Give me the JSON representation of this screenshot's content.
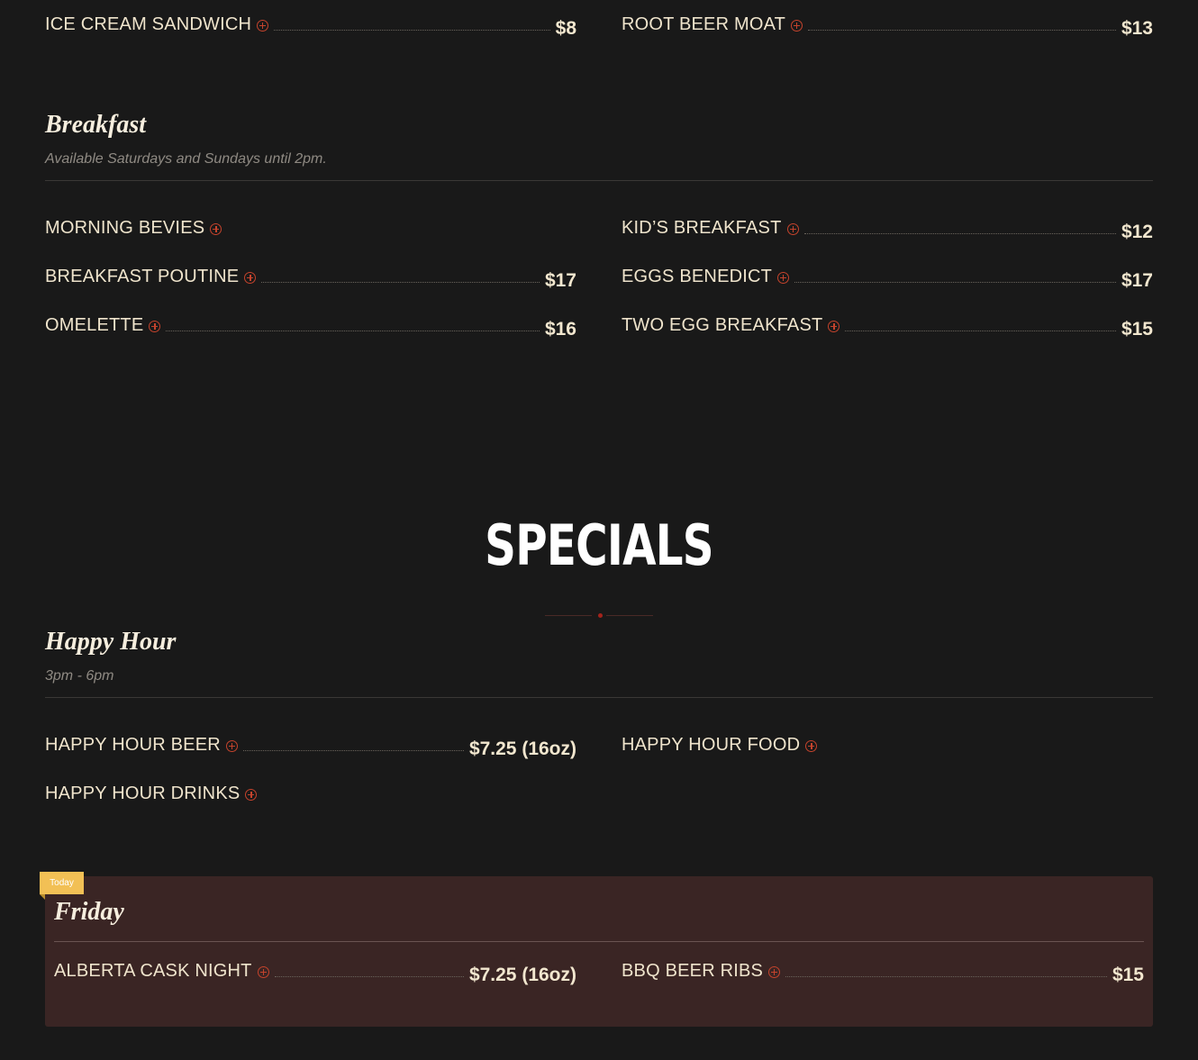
{
  "desserts": {
    "items": [
      {
        "name": "ICE CREAM SANDWICH",
        "price": "$8"
      },
      {
        "name": "ROOT BEER MOAT",
        "price": "$13"
      }
    ]
  },
  "breakfast": {
    "title": "Breakfast",
    "subtitle": "Available Saturdays and Sundays until 2pm.",
    "items": [
      {
        "name": "MORNING BEVIES",
        "price": ""
      },
      {
        "name": "KID’S BREAKFAST",
        "price": "$12"
      },
      {
        "name": "BREAKFAST POUTINE",
        "price": "$17"
      },
      {
        "name": "EGGS BENEDICT",
        "price": "$17"
      },
      {
        "name": "OMELETTE",
        "price": "$16"
      },
      {
        "name": "TWO EGG BREAKFAST",
        "price": "$15"
      }
    ]
  },
  "specials": {
    "heading": "SPECIALS"
  },
  "happy_hour": {
    "title": "Happy Hour",
    "subtitle": "3pm - 6pm",
    "items": [
      {
        "name": "HAPPY HOUR BEER",
        "price": "$7.25 (16oz)"
      },
      {
        "name": "HAPPY HOUR FOOD",
        "price": ""
      },
      {
        "name": "HAPPY HOUR DRINKS",
        "price": ""
      }
    ]
  },
  "today": {
    "badge": "Today",
    "title": "Friday",
    "items": [
      {
        "name": "ALBERTA CASK NIGHT",
        "price": "$7.25 (16oz)"
      },
      {
        "name": "BBQ BEER RIBS",
        "price": "$15"
      }
    ]
  },
  "colors": {
    "background": "#191919",
    "accent": "#c4432c",
    "text": "#efe4cc",
    "today_panel": "#3a2524",
    "today_badge": "#f2c055"
  },
  "icons": {
    "item_expand": "plus-circle-icon"
  }
}
